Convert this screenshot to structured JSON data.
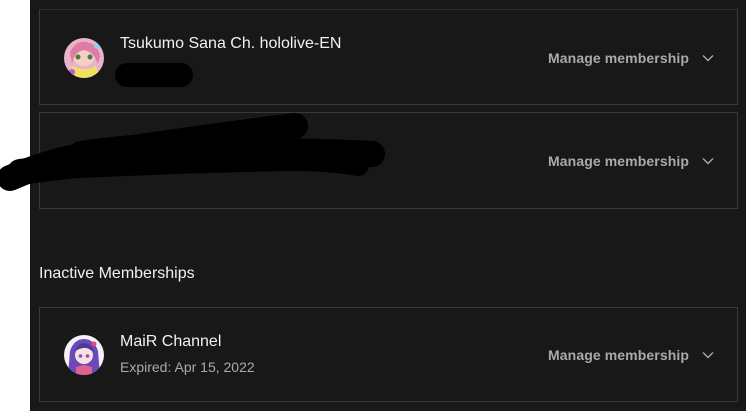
{
  "active_memberships": [
    {
      "channel_name": "Tsukumo Sana Ch. hololive-EN",
      "manage_label": "Manage membership",
      "avatar_icon": "avatar-tsukumo-sana"
    },
    {
      "manage_label": "Manage membership"
    }
  ],
  "inactive_section": {
    "heading": "Inactive Memberships",
    "items": [
      {
        "channel_name": "MaiR Channel",
        "status": "Expired: Apr 15, 2022",
        "manage_label": "Manage membership",
        "avatar_icon": "avatar-mair"
      }
    ]
  },
  "colors": {
    "background": "#181818",
    "card_border": "#3a3a3a",
    "primary_text": "#f1f1f1",
    "secondary_text": "#aaaaaa",
    "redaction": "#000000"
  }
}
